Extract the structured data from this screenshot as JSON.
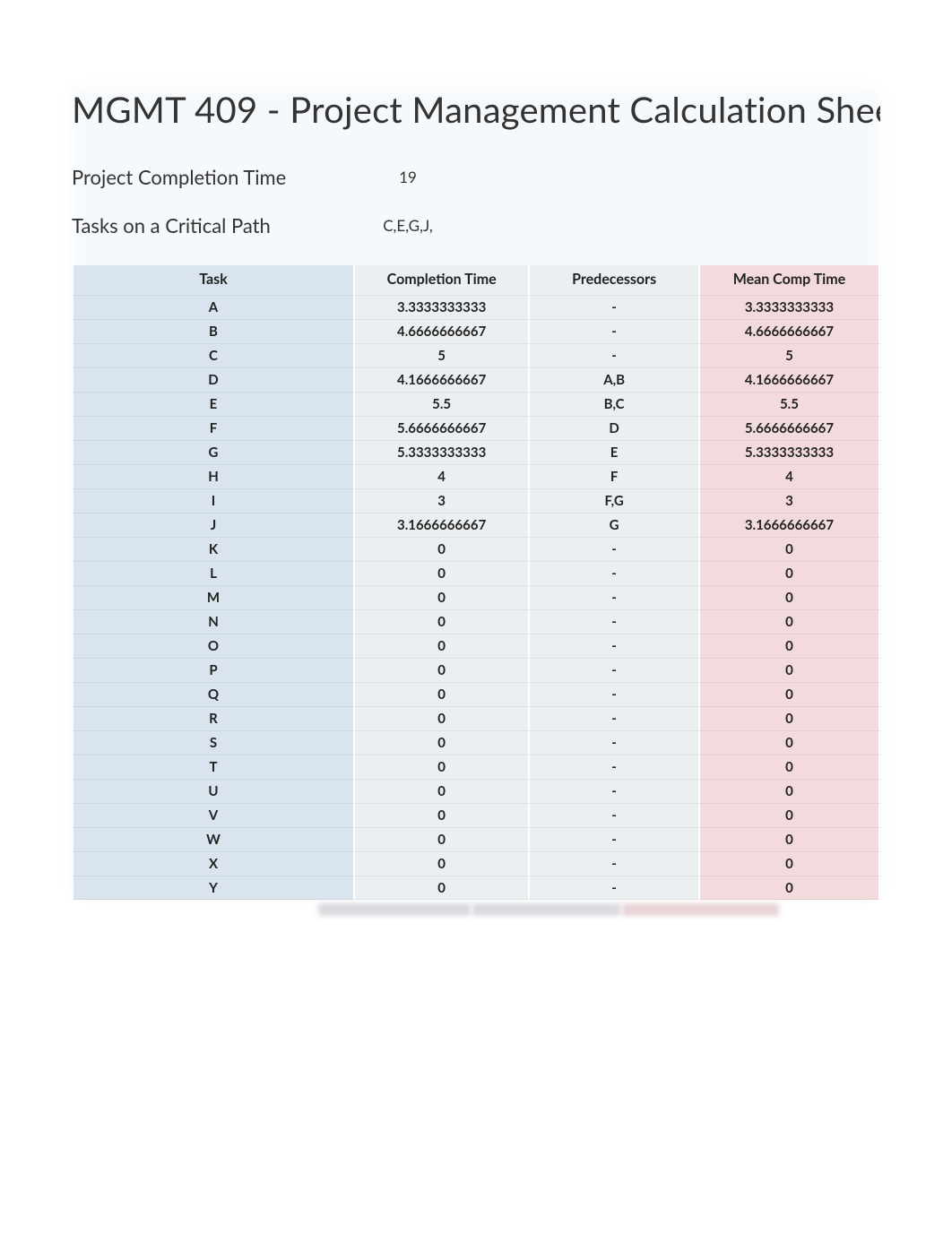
{
  "title": "MGMT 409 - Project Management Calculation Shee",
  "summary": {
    "completion_label": "Project Completion Time",
    "completion_value": "19",
    "critical_label": "Tasks on a Critical Path",
    "critical_value": "C,E,G,J,"
  },
  "headers": {
    "task": "Task",
    "completion_time": "Completion Time",
    "predecessors": "Predecessors",
    "mean_comp_time": "Mean Comp Time"
  },
  "rows": [
    {
      "task": "A",
      "completion_time": "3.3333333333",
      "predecessors": "-",
      "mean_comp_time": "3.3333333333"
    },
    {
      "task": "B",
      "completion_time": "4.6666666667",
      "predecessors": "-",
      "mean_comp_time": "4.6666666667"
    },
    {
      "task": "C",
      "completion_time": "5",
      "predecessors": "-",
      "mean_comp_time": "5"
    },
    {
      "task": "D",
      "completion_time": "4.1666666667",
      "predecessors": "A,B",
      "mean_comp_time": "4.1666666667"
    },
    {
      "task": "E",
      "completion_time": "5.5",
      "predecessors": "B,C",
      "mean_comp_time": "5.5"
    },
    {
      "task": "F",
      "completion_time": "5.6666666667",
      "predecessors": "D",
      "mean_comp_time": "5.6666666667"
    },
    {
      "task": "G",
      "completion_time": "5.3333333333",
      "predecessors": "E",
      "mean_comp_time": "5.3333333333"
    },
    {
      "task": "H",
      "completion_time": "4",
      "predecessors": "F",
      "mean_comp_time": "4"
    },
    {
      "task": "I",
      "completion_time": "3",
      "predecessors": "F,G",
      "mean_comp_time": "3"
    },
    {
      "task": "J",
      "completion_time": "3.1666666667",
      "predecessors": "G",
      "mean_comp_time": "3.1666666667"
    },
    {
      "task": "K",
      "completion_time": "0",
      "predecessors": "-",
      "mean_comp_time": "0"
    },
    {
      "task": "L",
      "completion_time": "0",
      "predecessors": "-",
      "mean_comp_time": "0"
    },
    {
      "task": "M",
      "completion_time": "0",
      "predecessors": "-",
      "mean_comp_time": "0"
    },
    {
      "task": "N",
      "completion_time": "0",
      "predecessors": "-",
      "mean_comp_time": "0"
    },
    {
      "task": "O",
      "completion_time": "0",
      "predecessors": "-",
      "mean_comp_time": "0"
    },
    {
      "task": "P",
      "completion_time": "0",
      "predecessors": "-",
      "mean_comp_time": "0"
    },
    {
      "task": "Q",
      "completion_time": "0",
      "predecessors": "-",
      "mean_comp_time": "0"
    },
    {
      "task": "R",
      "completion_time": "0",
      "predecessors": "-",
      "mean_comp_time": "0"
    },
    {
      "task": "S",
      "completion_time": "0",
      "predecessors": "-",
      "mean_comp_time": "0"
    },
    {
      "task": "T",
      "completion_time": "0",
      "predecessors": "-",
      "mean_comp_time": "0"
    },
    {
      "task": "U",
      "completion_time": "0",
      "predecessors": "-",
      "mean_comp_time": "0"
    },
    {
      "task": "V",
      "completion_time": "0",
      "predecessors": "-",
      "mean_comp_time": "0"
    },
    {
      "task": "W",
      "completion_time": "0",
      "predecessors": "-",
      "mean_comp_time": "0"
    },
    {
      "task": "X",
      "completion_time": "0",
      "predecessors": "-",
      "mean_comp_time": "0"
    },
    {
      "task": "Y",
      "completion_time": "0",
      "predecessors": "-",
      "mean_comp_time": "0"
    }
  ]
}
